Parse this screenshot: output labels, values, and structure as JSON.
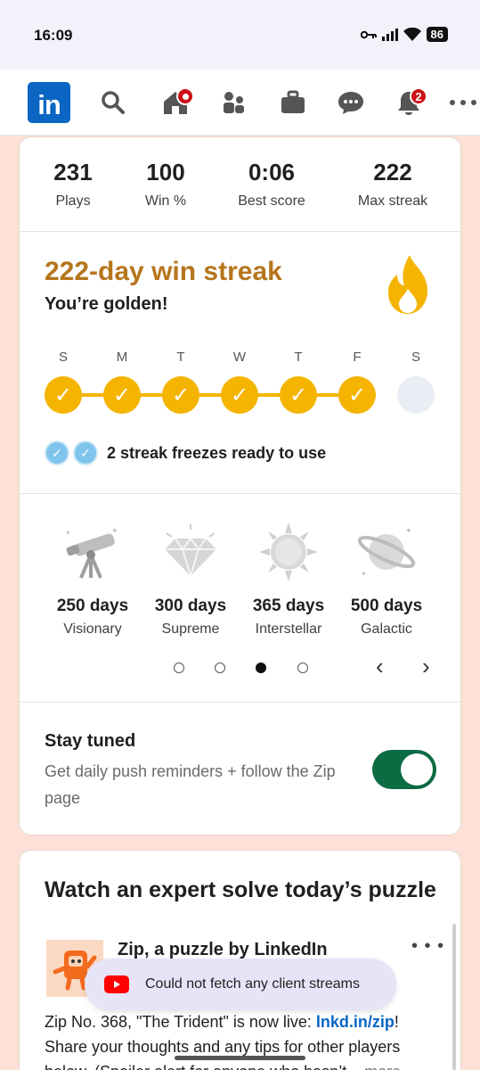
{
  "status": {
    "time": "16:09",
    "battery": "86"
  },
  "nav": {
    "messages_badge": "",
    "notifications_badge": "2"
  },
  "stats": [
    {
      "value": "231",
      "label": "Plays"
    },
    {
      "value": "100",
      "label": "Win %"
    },
    {
      "value": "0:06",
      "label": "Best score"
    },
    {
      "value": "222",
      "label": "Max streak"
    }
  ],
  "streak": {
    "title": "222-day win streak",
    "subtitle": "You’re golden!",
    "days": [
      "S",
      "M",
      "T",
      "W",
      "T",
      "F",
      "S"
    ],
    "completed": [
      true,
      true,
      true,
      true,
      true,
      true,
      false
    ],
    "freezes_text": "2 streak freezes ready to use"
  },
  "milestones": [
    {
      "days": "250 days",
      "name": "Visionary",
      "icon": "telescope-icon"
    },
    {
      "days": "300 days",
      "name": "Supreme",
      "icon": "diamond-icon"
    },
    {
      "days": "365 days",
      "name": "Interstellar",
      "icon": "sun-icon"
    },
    {
      "days": "500 days",
      "name": "Galactic",
      "icon": "planet-icon"
    }
  ],
  "pager": {
    "count": 4,
    "active": 3
  },
  "stay_tuned": {
    "title": "Stay tuned",
    "description": "Get daily push reminders + follow the Zip page",
    "toggle_on": true
  },
  "watch": {
    "title": "Watch an expert solve today’s puzzle",
    "author": "Zip, a puzzle by LinkedIn",
    "text_before_link": "Zip No. 368, \"The Trident\" is now live: ",
    "link": "lnkd.in/zip",
    "text_after_link": "! Share your thoughts and any tips for other players below. (Spoiler alert for anyone who hasn’t ",
    "more": "...more"
  },
  "toast": {
    "text": "Could not fetch any client streams"
  },
  "colors": {
    "accent": "#f4b400",
    "brand": "#0a66c2",
    "streak_title": "#b6751c",
    "toggle": "#0b6b43"
  }
}
